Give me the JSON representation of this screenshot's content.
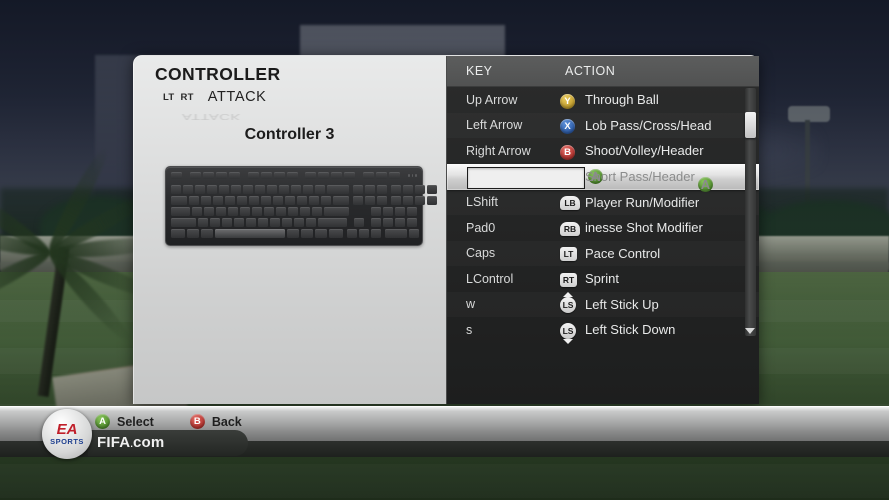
{
  "dialog": {
    "title": "CONTROLLER",
    "trigger_left": "LT",
    "trigger_right": "RT",
    "tab_label": "ATTACK",
    "controller_label": "Controller 3",
    "keyboard_icon": "keyboard-illustration"
  },
  "list": {
    "header": {
      "key": "KEY",
      "action": "ACTION"
    },
    "rows": [
      {
        "key": "Up Arrow",
        "button": "Y",
        "button_type": "face",
        "action": "Through Ball",
        "selected": false
      },
      {
        "key": "Left Arrow",
        "button": "X",
        "button_type": "face",
        "action": "Lob Pass/Cross/Head",
        "selected": false
      },
      {
        "key": "Right Arrow",
        "button": "B",
        "button_type": "face",
        "action": "Shoot/Volley/Header",
        "selected": false
      },
      {
        "key": "",
        "button": "A",
        "button_type": "face",
        "action": "Short Pass/Header",
        "selected": true
      },
      {
        "key": "LShift",
        "button": "LB",
        "button_type": "shoulder",
        "action": "Player Run/Modifier",
        "selected": false
      },
      {
        "key": "Pad0",
        "button": "RB",
        "button_type": "shoulder",
        "action": "inesse Shot Modifier",
        "selected": false
      },
      {
        "key": "Caps",
        "button": "LT",
        "button_type": "trigger",
        "action": "Pace Control",
        "selected": false
      },
      {
        "key": "LControl",
        "button": "RT",
        "button_type": "trigger",
        "action": "Sprint",
        "selected": false
      },
      {
        "key": "w",
        "button": "LS",
        "button_type": "stick-up",
        "action": "Left Stick Up",
        "selected": false
      },
      {
        "key": "s",
        "button": "LS",
        "button_type": "stick-down",
        "action": "Left Stick Down",
        "selected": false
      }
    ],
    "edit_value": "",
    "edit_placeholder": "",
    "selected_prefix_button": "A"
  },
  "footer": {
    "select_label": "Select",
    "select_button": "A",
    "back_label": "Back",
    "back_button": "B",
    "brand_top": "EA",
    "brand_bottom": "SPORTS",
    "site": "FIFA",
    "site_sub": ".",
    "site_end": "com"
  },
  "colors": {
    "button_a": "#4f9b22",
    "button_b": "#bf2420",
    "button_x": "#2457a8",
    "button_y": "#c8a122",
    "panel_bg": "#d8d9d9",
    "list_bg": "#252626",
    "accent_text": "#e8e9e9"
  }
}
